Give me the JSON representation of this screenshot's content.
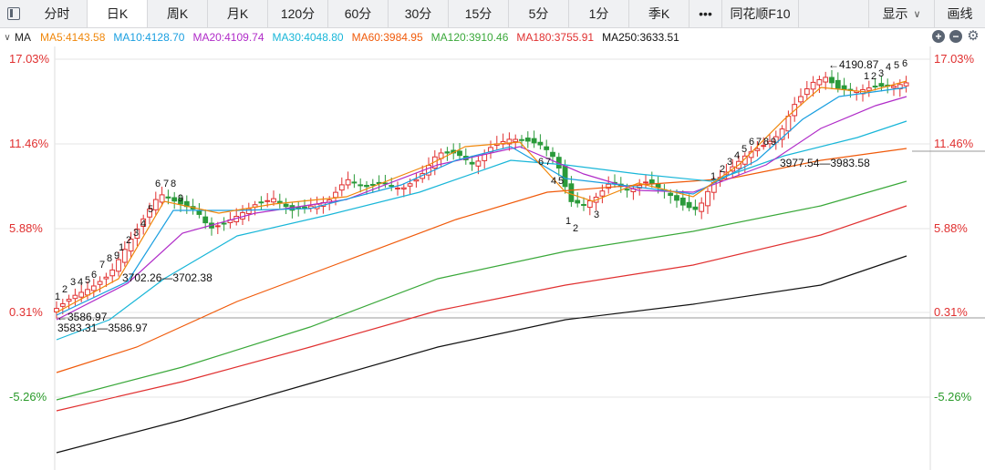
{
  "toolbar": {
    "tabs": [
      {
        "label": "分时",
        "active": false
      },
      {
        "label": "日K",
        "active": true
      },
      {
        "label": "周K",
        "active": false
      },
      {
        "label": "月K",
        "active": false
      },
      {
        "label": "120分",
        "active": false
      },
      {
        "label": "60分",
        "active": false
      },
      {
        "label": "30分",
        "active": false
      },
      {
        "label": "15分",
        "active": false
      },
      {
        "label": "5分",
        "active": false
      },
      {
        "label": "1分",
        "active": false
      },
      {
        "label": "季K",
        "active": false
      },
      {
        "label": "•••",
        "active": false
      },
      {
        "label": "同花顺F10",
        "active": false
      }
    ],
    "display_label": "显示",
    "draw_label": "画线"
  },
  "ma_legend": {
    "toggle_label": "MA",
    "items": [
      {
        "text": "MA5:4143.58",
        "color": "#f0870a"
      },
      {
        "text": "MA10:4128.70",
        "color": "#1a9fe0"
      },
      {
        "text": "MA20:4109.74",
        "color": "#b02cc8"
      },
      {
        "text": "MA30:4048.80",
        "color": "#18b6d8"
      },
      {
        "text": "MA60:3984.95",
        "color": "#f05a0a"
      },
      {
        "text": "MA120:3910.46",
        "color": "#3aa83a"
      },
      {
        "text": "MA180:3755.91",
        "color": "#e03030"
      },
      {
        "text": "MA250:3633.51",
        "color": "#111111"
      }
    ]
  },
  "axis": {
    "left_labels": [
      {
        "text": "17.03%",
        "color": "#e03030"
      },
      {
        "text": "11.46%",
        "color": "#e03030"
      },
      {
        "text": "5.88%",
        "color": "#e03030"
      },
      {
        "text": "0.31%",
        "color": "#e03030"
      },
      {
        "text": "-5.26%",
        "color": "#2a9a2a"
      }
    ],
    "right_labels": [
      {
        "text": "17.03%",
        "color": "#e03030"
      },
      {
        "text": "11.46%",
        "color": "#e03030"
      },
      {
        "text": "5.88%",
        "color": "#e03030"
      },
      {
        "text": "0.31%",
        "color": "#e03030"
      },
      {
        "text": "-5.26%",
        "color": "#2a9a2a"
      }
    ]
  },
  "annotations": {
    "low": "←3586.97",
    "low_range": "3583.31—3586.97",
    "mid_range": "3702.26—3702.38",
    "gap_range": "3977.54—3983.58",
    "high": "←4190.87",
    "seq_labels": [
      "1",
      "2",
      "3",
      "4",
      "5",
      "6",
      "7",
      "8",
      "9"
    ]
  },
  "colors": {
    "up": "#e03030",
    "down": "#2a9a3a",
    "grid": "#e6e6e6"
  }
}
